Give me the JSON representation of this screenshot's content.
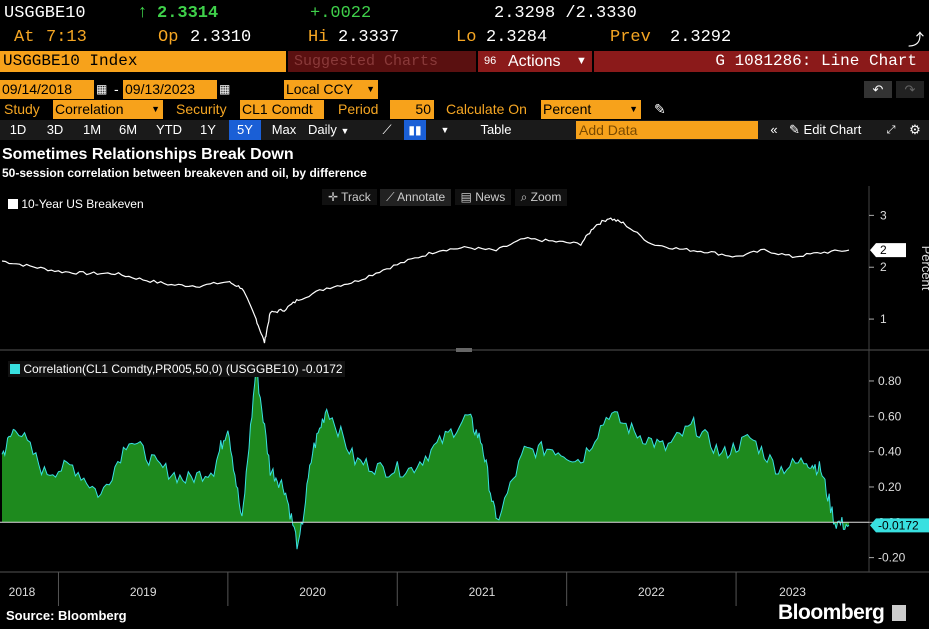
{
  "header": {
    "ticker": "USGGBE10",
    "last": "2.3314",
    "change": "+.0022",
    "bid_ask": "2.3298 /2.3330",
    "at_label": "At",
    "at_time": "7:13",
    "op_label": "Op",
    "op_value": "2.3310",
    "hi_label": "Hi",
    "hi_value": "2.3337",
    "lo_label": "Lo",
    "lo_value": "2.3284",
    "prev_label": "Prev",
    "prev_value": "2.3292"
  },
  "toolbar": {
    "security_index": "USGGBE10 Index",
    "suggested_charts": "Suggested Charts",
    "actions_code": "96",
    "actions_label": "Actions",
    "chart_code": "G 1081286: Line Chart",
    "date_from": "09/14/2018",
    "date_to": "09/13/2023",
    "currency": "Local CCY",
    "study_label": "Study",
    "study_value": "Correlation",
    "security_label": "Security",
    "security_value": "CL1 Comdt",
    "period_label": "Period",
    "period_value": "50",
    "calc_label": "Calculate On",
    "calc_value": "Percent",
    "ranges": [
      "1D",
      "3D",
      "1M",
      "6M",
      "YTD",
      "1Y",
      "5Y",
      "Max"
    ],
    "selected_range": "5Y",
    "frequency": "Daily",
    "table_label": "Table",
    "add_data_placeholder": "Add Data",
    "edit_chart": "Edit Chart",
    "track": "Track",
    "annotate": "Annotate",
    "news": "News",
    "zoom": "Zoom"
  },
  "footer": {
    "source": "Source: Bloomberg",
    "brand": "Bloomberg"
  },
  "colors": {
    "orange": "#f7a21b",
    "red_bar": "#8b1a1a",
    "green_fill": "#1e8a1e",
    "cyan_line": "#38e0e0",
    "white_line": "#ffffff"
  },
  "chart_data": [
    {
      "type": "line",
      "title": "Sometimes Relationships Break Down",
      "subtitle": "50-session correlation between breakeven and oil, by difference",
      "legend": "10-Year US Breakeven",
      "ylabel": "Percent",
      "yticks": [
        1,
        2,
        3
      ],
      "ylim": [
        0.5,
        3.2
      ],
      "last_value_label": "2",
      "x": [
        "2018-09",
        "2018-11",
        "2019-01",
        "2019-03",
        "2019-05",
        "2019-07",
        "2019-09",
        "2019-11",
        "2020-01",
        "2020-02",
        "2020-03",
        "2020-03-19",
        "2020-04",
        "2020-05",
        "2020-06",
        "2020-08",
        "2020-10",
        "2020-12",
        "2021-02",
        "2021-04",
        "2021-06",
        "2021-08",
        "2021-10",
        "2021-12",
        "2022-02",
        "2022-03",
        "2022-04",
        "2022-05",
        "2022-07",
        "2022-09",
        "2022-11",
        "2023-01",
        "2023-03",
        "2023-05",
        "2023-07",
        "2023-09"
      ],
      "values": [
        2.12,
        2.02,
        1.92,
        1.88,
        1.88,
        1.76,
        1.66,
        1.64,
        1.72,
        1.6,
        1.0,
        0.55,
        1.12,
        1.18,
        1.38,
        1.6,
        1.72,
        1.95,
        2.15,
        2.33,
        2.38,
        2.32,
        2.55,
        2.5,
        2.45,
        2.8,
        2.95,
        2.85,
        2.45,
        2.35,
        2.3,
        2.2,
        2.33,
        2.2,
        2.28,
        2.33
      ]
    },
    {
      "type": "area",
      "legend": "Correlation(CL1 Comdty,PR005,50,0) (USGGBE10) -0.0172",
      "last_value_label": "-0.0172",
      "yticks": [
        -0.2,
        0.0,
        0.2,
        0.4,
        0.6,
        0.8
      ],
      "ylim": [
        -0.27,
        0.93
      ],
      "xticks": [
        "2018",
        "2019",
        "2020",
        "2021",
        "2022",
        "2023"
      ],
      "x": [
        "2018-09",
        "2018-10",
        "2018-12",
        "2019-02",
        "2019-04",
        "2019-06",
        "2019-08",
        "2019-10",
        "2019-12",
        "2020-01",
        "2020-02",
        "2020-03",
        "2020-04",
        "2020-05",
        "2020-06",
        "2020-07",
        "2020-08",
        "2020-10",
        "2020-12",
        "2021-02",
        "2021-04",
        "2021-06",
        "2021-07",
        "2021-08",
        "2021-10",
        "2021-12",
        "2022-02",
        "2022-04",
        "2022-06",
        "2022-08",
        "2022-10",
        "2022-12",
        "2023-02",
        "2023-04",
        "2023-06",
        "2023-07",
        "2023-08",
        "2023-09"
      ],
      "values": [
        0.38,
        0.55,
        0.28,
        0.32,
        0.15,
        0.48,
        0.32,
        0.24,
        0.3,
        0.55,
        0.0,
        0.88,
        0.3,
        0.2,
        -0.15,
        0.4,
        0.65,
        0.35,
        0.3,
        0.3,
        0.45,
        0.6,
        0.45,
        0.0,
        0.4,
        0.42,
        0.35,
        0.62,
        0.5,
        0.42,
        0.55,
        0.38,
        0.48,
        0.3,
        0.35,
        0.3,
        0.0,
        -0.0172
      ]
    }
  ]
}
